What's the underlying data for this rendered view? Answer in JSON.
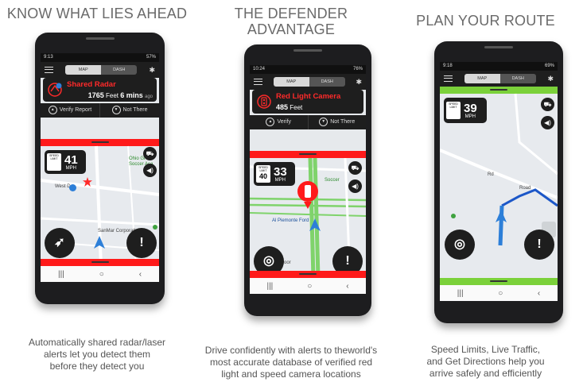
{
  "panels": [
    {
      "heading_lines": [
        "KNOW WHAT LIES AHEAD"
      ],
      "status": {
        "time": "9:13",
        "right": "57%"
      },
      "tabs": {
        "map": "MAP",
        "dash": "DASH"
      },
      "alert": {
        "title": "Shared Radar",
        "distance": "1765",
        "unit": "Feet",
        "eta": "6 mins",
        "eta_suffix": "ago"
      },
      "actions": {
        "verify": "Verify Report",
        "not_there": "Not There"
      },
      "speed": {
        "limit_label": "SPEED LIMIT",
        "limit": "",
        "current": "41",
        "unit": "MPH"
      },
      "map_labels": [
        "Ohio Gr",
        "Soccer Aca",
        "West D",
        "SanMar Corporation"
      ],
      "caption_lines": [
        "Automatically shared radar/laser",
        "alerts let you detect them",
        "before they detect you"
      ],
      "colors": {
        "bar": "#ff1a1a"
      }
    },
    {
      "heading_lines": [
        "THE DEFENDER",
        "ADVANTAGE"
      ],
      "status": {
        "time": "10:24",
        "right": "76%"
      },
      "tabs": {
        "map": "MAP",
        "dash": "DASH"
      },
      "alert": {
        "title": "Red Light Camera",
        "distance": "485",
        "unit": "Feet",
        "eta": "",
        "eta_suffix": ""
      },
      "actions": {
        "verify": "Verify",
        "not_there": "Not There"
      },
      "speed": {
        "limit_label": "SPEED LIMIT",
        "limit": "40",
        "current": "33",
        "unit": "MPH"
      },
      "map_labels": [
        "Soccer",
        "Al Piemonte Ford",
        "Broadmoor"
      ],
      "caption_lines": [
        "Drive confidently with alerts to theworld's",
        "most accurate database of verified red",
        "light and speed camera locations"
      ],
      "colors": {
        "bar": "#ff1a1a"
      }
    },
    {
      "heading_lines": [
        "PLAN YOUR ROUTE"
      ],
      "status": {
        "time": "9:18",
        "right": "69%"
      },
      "tabs": {
        "map": "MAP",
        "dash": "DASH"
      },
      "speed": {
        "limit_label": "SPEED LIMIT",
        "limit": "",
        "current": "39",
        "unit": "MPH"
      },
      "map_labels": [
        "Rd",
        "Road"
      ],
      "caption_lines": [
        "Speed Limits, Live Traffic,",
        "and Get Directions help you",
        "arrive safely and efficiently"
      ],
      "colors": {
        "bar": "#7bd13a"
      }
    }
  ],
  "nav": {
    "recents": "|||",
    "home": "○",
    "back": "‹"
  },
  "icons": [
    "menu-icon",
    "bluetooth-icon",
    "radar-icon",
    "camera-icon",
    "thumbs-up-icon",
    "thumbs-down-icon",
    "car-icon",
    "volume-icon",
    "compass-icon",
    "locate-icon",
    "alert-icon",
    "arrow-icon"
  ]
}
